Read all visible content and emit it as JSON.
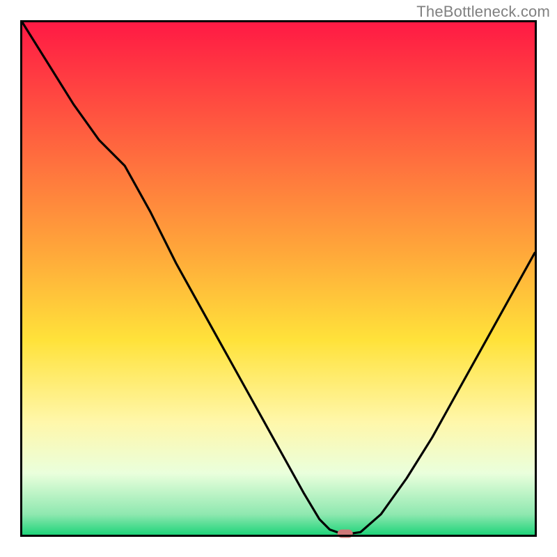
{
  "watermark": "TheBottleneck.com",
  "colors": {
    "frame": "#000000",
    "curve": "#000000",
    "marker": "#d07878",
    "grad_top": "#ff1a44",
    "grad_mid1": "#ffa83a",
    "grad_mid2": "#ffe23a",
    "grad_mid3": "#fff7aa",
    "grad_mid4": "#eaffdc",
    "grad_bottom": "#1fd47a"
  },
  "chart_data": {
    "type": "line",
    "title": "",
    "xlabel": "",
    "ylabel": "",
    "xlim": [
      0,
      100
    ],
    "ylim": [
      0,
      100
    ],
    "x": [
      0,
      5,
      10,
      15,
      20,
      25,
      30,
      35,
      40,
      45,
      50,
      55,
      58,
      60,
      62,
      64,
      66,
      70,
      75,
      80,
      85,
      90,
      95,
      100
    ],
    "y": [
      100,
      92,
      84,
      77,
      72,
      63,
      53,
      44,
      35,
      26,
      17,
      8,
      3,
      1,
      0.3,
      0.2,
      0.5,
      4,
      11,
      19,
      28,
      37,
      46,
      55
    ],
    "marker": {
      "x": 63,
      "y": 0.2
    },
    "gradient_stops_pct": [
      0,
      45,
      62,
      78,
      88,
      96,
      100
    ],
    "notes": "Values in percent of plot area; y=0 is the bottom axis (green), y=100 is top (red)."
  }
}
